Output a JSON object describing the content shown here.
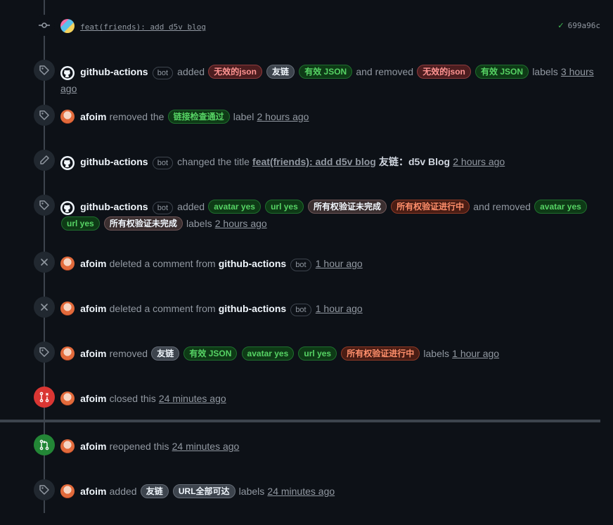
{
  "labels": {
    "invalid_json": {
      "text": "无效的json",
      "fg": "#ff9492",
      "bg": "#4c1d1f",
      "border": "#8e3b3d"
    },
    "friend_link": {
      "text": "友链",
      "fg": "#f0f6fc",
      "bg": "#3d444d",
      "border": "#656c76"
    },
    "valid_json": {
      "text": "有效 JSON",
      "fg": "#56d364",
      "bg": "#0e3a16",
      "border": "#1f6f2e"
    },
    "link_check_pass": {
      "text": "链接检查通过",
      "fg": "#56d364",
      "bg": "#0e3a16",
      "border": "#1f6f2e"
    },
    "avatar_yes": {
      "text": "avatar yes",
      "fg": "#56d364",
      "bg": "#0e3a16",
      "border": "#1f6f2e"
    },
    "url_yes": {
      "text": "url yes",
      "fg": "#56d364",
      "bg": "#0e3a16",
      "border": "#1f6f2e"
    },
    "ownership_incomplete": {
      "text": "所有权验证未完成",
      "fg": "#f0f6fc",
      "bg": "#3b2f30",
      "border": "#6e5657"
    },
    "ownership_in_progress": {
      "text": "所有权验证进行中",
      "fg": "#ff8f6b",
      "bg": "#4a1d14",
      "border": "#8f3a26"
    },
    "url_all_reachable": {
      "text": "URL全部可达",
      "fg": "#f0f6fc",
      "bg": "#3d444d",
      "border": "#656c76"
    }
  },
  "events": [
    {
      "kind": "commit",
      "message": "feat(friends): add d5v blog",
      "sha": "699a96c"
    },
    {
      "actor": "github-actions",
      "bot": "bot",
      "w_added": "added",
      "w_removed": "and removed",
      "w_labels": "labels",
      "time": "3 hours ago"
    },
    {
      "actor": "afoim",
      "w_removed": "removed the",
      "w_label": "label",
      "time": "2 hours ago"
    },
    {
      "actor": "github-actions",
      "bot": "bot",
      "w_changed": "changed the title",
      "old_title": "feat(friends): add d5v blog",
      "new_title": "友链：d5v Blog",
      "time": "2 hours ago"
    },
    {
      "actor": "github-actions",
      "bot": "bot",
      "w_added": "added",
      "w_removed": "and removed",
      "w_labels": "labels",
      "time": "2 hours ago"
    },
    {
      "actor": "afoim",
      "w_deleted": "deleted a comment from",
      "target": "github-actions",
      "bot": "bot",
      "time": "1 hour ago"
    },
    {
      "actor": "afoim",
      "w_deleted": "deleted a comment from",
      "target": "github-actions",
      "bot": "bot",
      "time": "1 hour ago"
    },
    {
      "actor": "afoim",
      "w_removed": "removed",
      "w_labels": "labels",
      "time": "1 hour ago"
    },
    {
      "actor": "afoim",
      "w_closed": "closed this",
      "time": "24 minutes ago"
    },
    {
      "actor": "afoim",
      "w_reopened": "reopened this",
      "time": "24 minutes ago"
    },
    {
      "actor": "afoim",
      "w_added": "added",
      "w_labels": "labels",
      "time": "24 minutes ago"
    }
  ]
}
